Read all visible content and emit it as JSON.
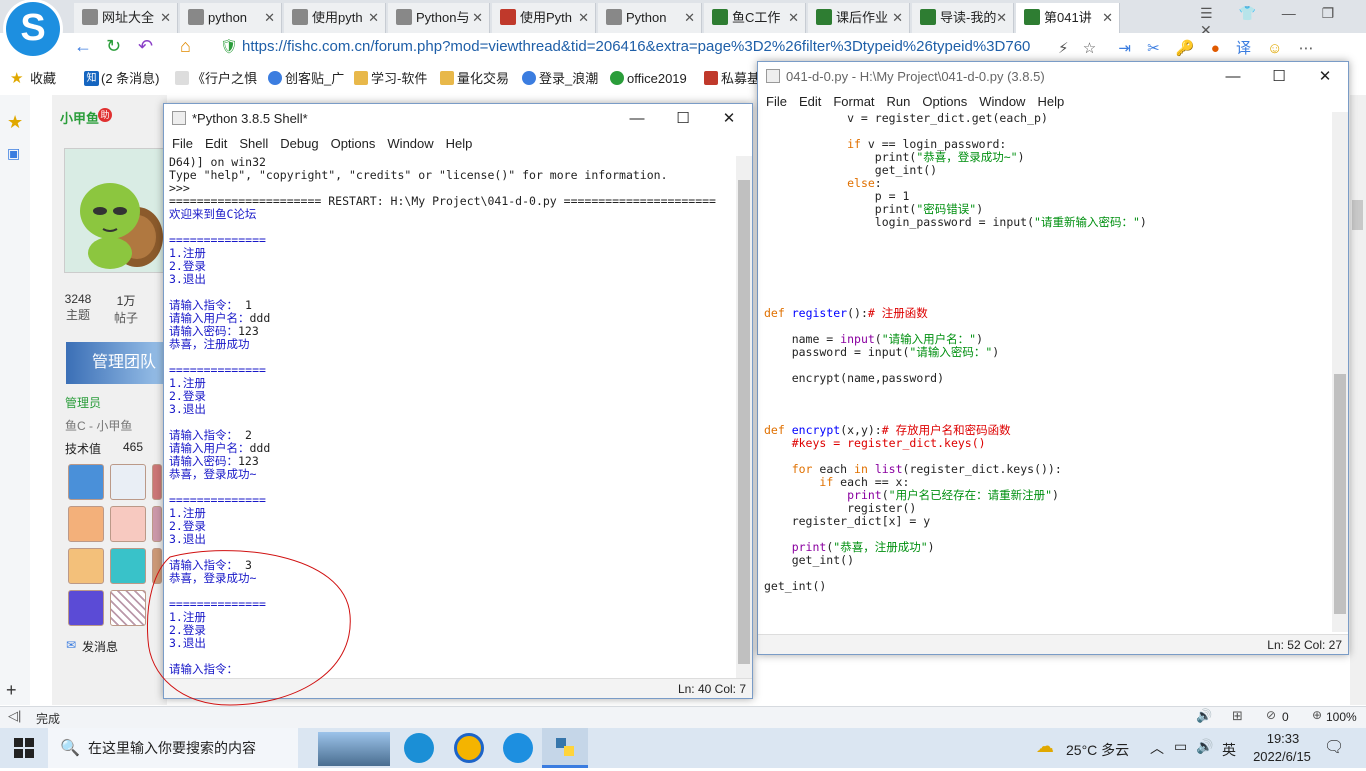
{
  "browser": {
    "tabs": [
      {
        "label": "网址大全",
        "icon": "globe-icon",
        "color": "#888888"
      },
      {
        "label": "python",
        "icon": "page-icon",
        "color": "#888888"
      },
      {
        "label": "使用pyth",
        "icon": "page-icon",
        "color": "#888888"
      },
      {
        "label": "Python与",
        "icon": "page-icon",
        "color": "#888888"
      },
      {
        "label": "使用Pyth",
        "icon": "brand-icon",
        "color": "#c0392b"
      },
      {
        "label": "Python",
        "icon": "page-icon",
        "color": "#888888"
      },
      {
        "label": "鱼C工作",
        "icon": "fc-icon",
        "color": "#2e7d32"
      },
      {
        "label": "课后作业",
        "icon": "fc-icon",
        "color": "#2e7d32"
      },
      {
        "label": "导读-我的",
        "icon": "fc-icon",
        "color": "#2e7d32"
      },
      {
        "label": "第041讲",
        "icon": "fc-icon",
        "color": "#2e7d32",
        "active": true
      }
    ],
    "url": "https://fishc.com.cn/forum.php?mod=viewthread&tid=206416&extra=page%3D2%26filter%3Dtypeid%26typeid%3D760",
    "bookmarks": [
      "收藏",
      "(2 条消息)",
      "《行户之惧",
      "创客贴_广",
      "学习-软件",
      "量化交易",
      "登录_浪潮",
      "office2019",
      "私募基"
    ],
    "status_text": "完成",
    "zoom": "100%",
    "count_zero": "0"
  },
  "profile": {
    "name": "小甲鱼",
    "stats": [
      {
        "value": "3248",
        "label": "主题"
      },
      {
        "value": "1万",
        "label": "帖子"
      }
    ],
    "banner": "管理团队",
    "role": "管理员",
    "sub_role": "鱼C - 小甲鱼",
    "tech_label": "技术值",
    "tech_value": "465",
    "message": "发消息"
  },
  "shell": {
    "title": "*Python 3.8.5 Shell*",
    "menu": [
      "File",
      "Edit",
      "Shell",
      "Debug",
      "Options",
      "Window",
      "Help"
    ],
    "status": "Ln: 40  Col: 7"
  },
  "editor": {
    "title": "041-d-0.py - H:\\My Project\\041-d-0.py (3.8.5)",
    "menu": [
      "File",
      "Edit",
      "Format",
      "Run",
      "Options",
      "Window",
      "Help"
    ],
    "status": "Ln: 52  Col: 27"
  },
  "taskbar": {
    "search_placeholder": "在这里输入你要搜索的内容",
    "weather": "25°C  多云",
    "ime": "英",
    "time": "19:33",
    "date": "2022/6/15"
  }
}
